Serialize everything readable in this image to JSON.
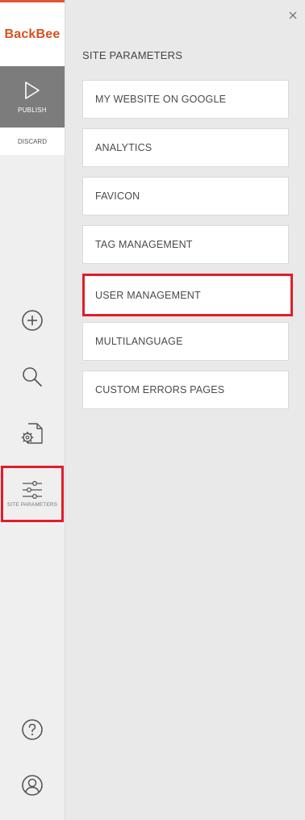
{
  "app": {
    "logo_back": "Back",
    "logo_bee": "Bee"
  },
  "sidebar": {
    "publish_label": "PUBLISH",
    "discard_label": "DISCARD",
    "site_parameters_label": "SITE PARAMETERS",
    "icons": {
      "add": "add-circle-icon",
      "search": "search-icon",
      "page_settings": "page-settings-icon",
      "site_parameters": "sliders-icon",
      "help": "help-icon",
      "user": "user-icon"
    }
  },
  "panel": {
    "title": "SITE PARAMETERS",
    "items": [
      {
        "label": "MY WEBSITE ON GOOGLE"
      },
      {
        "label": "ANALYTICS"
      },
      {
        "label": "FAVICON"
      },
      {
        "label": "TAG MANAGEMENT"
      },
      {
        "label": "USER MANAGEMENT"
      },
      {
        "label": "MULTILANGUAGE"
      },
      {
        "label": "CUSTOM ERRORS PAGES"
      }
    ]
  },
  "colors": {
    "brand": "#d8501f",
    "highlight": "#e11d2a",
    "publish_bg": "#7c7c7c"
  }
}
